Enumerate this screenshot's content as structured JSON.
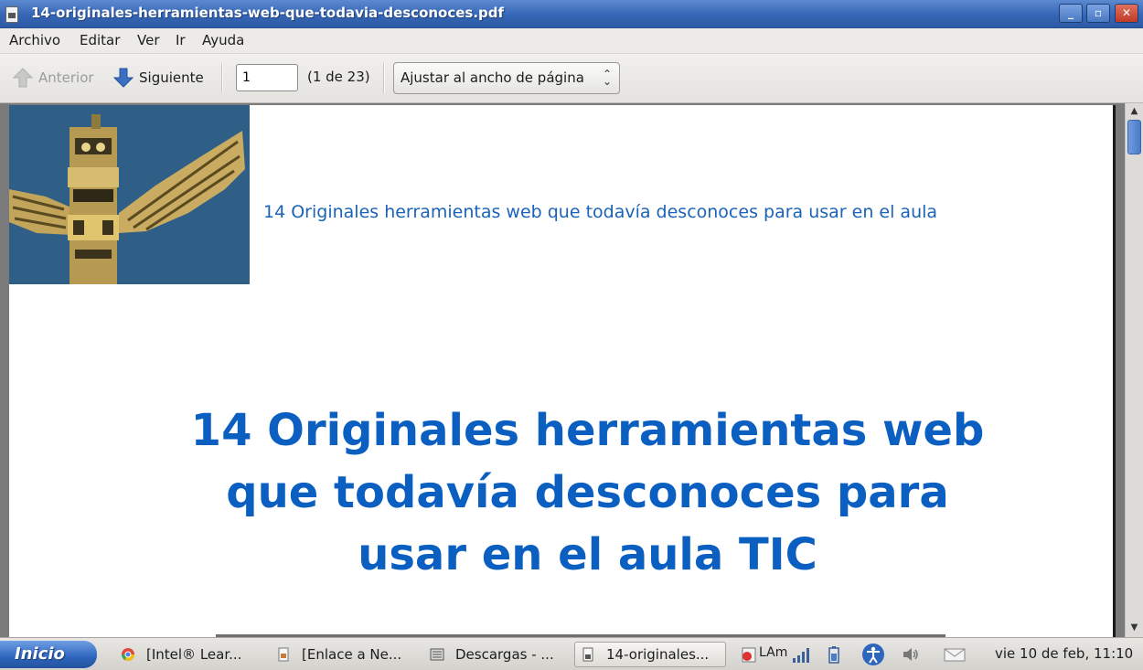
{
  "window": {
    "title": "14-originales-herramientas-web-que-todavia-desconoces.pdf",
    "buttons": {
      "minimize": "_",
      "maximize": "▫",
      "close": "✕"
    }
  },
  "menu": [
    "Archivo",
    "Editar",
    "Ver",
    "Ir",
    "Ayuda"
  ],
  "toolbar": {
    "previous_label": "Anterior",
    "next_label": "Siguiente",
    "page_value": "1",
    "page_count": "(1 de 23)",
    "zoom_value": "Ajustar al ancho de página"
  },
  "document": {
    "header_title": "14 Originales herramientas web que todavía desconoces para usar en el aula",
    "main_title_lines": [
      "14 Originales herramientas web",
      "que todavía desconoces para",
      "usar en el aula TIC"
    ]
  },
  "taskbar": {
    "start_label": "Inicio",
    "tasks": [
      {
        "label": "[Intel® Lear...",
        "icon": "chrome-icon"
      },
      {
        "label": "[Enlace a Ne...",
        "icon": "document-icon"
      },
      {
        "label": "Descargas - ...",
        "icon": "folder-icon"
      },
      {
        "label": "14-originales...",
        "icon": "pdf-icon",
        "active": true
      }
    ],
    "tray_text": "LAm",
    "clock": "vie 10 de feb, 11:10"
  },
  "colors": {
    "accent": "#0b5fc0",
    "header_link": "#1a63b8",
    "titlebar": "#3566b6"
  }
}
